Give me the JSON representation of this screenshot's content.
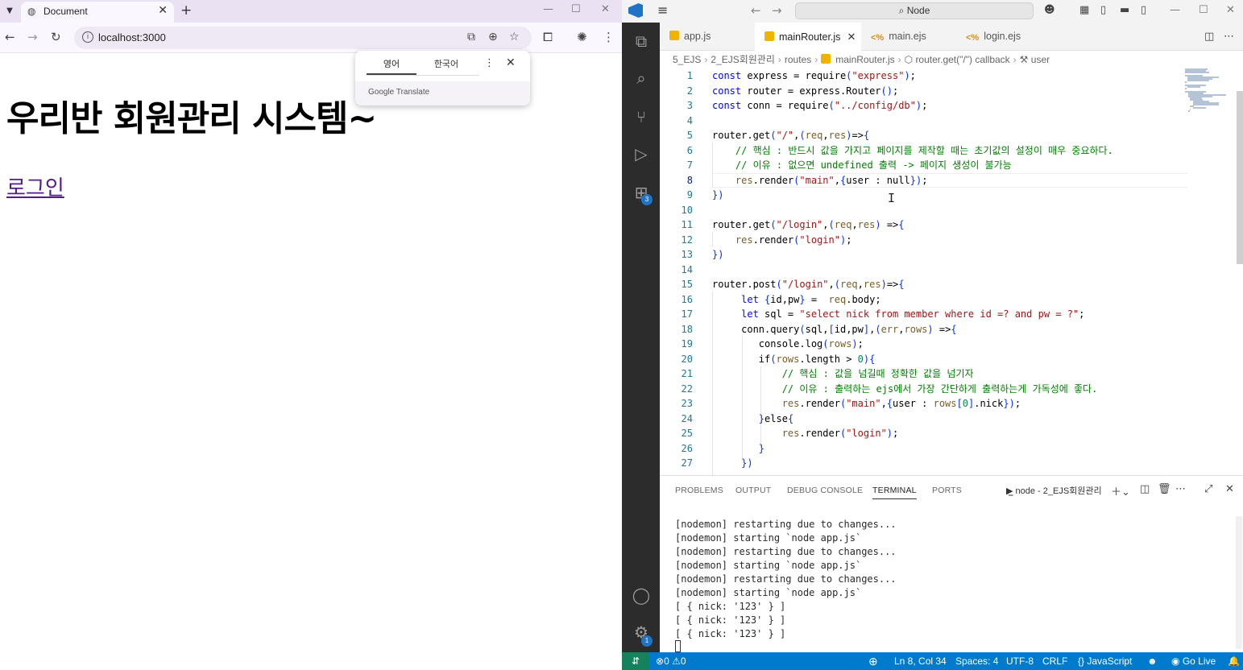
{
  "browser": {
    "tab_title": "Document",
    "new_tab": "+",
    "url": "localhost:3000",
    "translate_popup": {
      "tab_source": "영어",
      "tab_target": "한국어",
      "brand": "Google Translate"
    },
    "page": {
      "heading": "우리반 회원관리 시스템~",
      "login_link": "로그인"
    }
  },
  "vscode": {
    "search_text": "Node",
    "tabs": [
      {
        "label": "app.js",
        "icon": "js-file-icon"
      },
      {
        "label": "mainRouter.js",
        "icon": "js-file-icon",
        "active": true
      },
      {
        "label": "main.ejs",
        "icon": "ejs-file-icon"
      },
      {
        "label": "login.ejs",
        "icon": "ejs-file-icon"
      }
    ],
    "breadcrumb": [
      "5_EJS",
      "2_EJS회원관리",
      "routes",
      "mainRouter.js",
      "router.get(\"/\") callback",
      "user"
    ],
    "extensions_badge": "3",
    "settings_badge": "1",
    "code_lines": [
      "const express = require(\"express\");",
      "const router = express.Router();",
      "const conn = require(\"../config/db\");",
      "",
      "router.get(\"/\",(req,res)=>{",
      "    // 핵심 : 반드시 값을 가지고 페이지를 제작할 때는 초기값의 설정이 매우 중요하다.",
      "    // 이유 : 없으면 undefined 출력 -> 페이지 생성이 불가능",
      "    res.render(\"main\",{user : null});",
      "})",
      "",
      "router.get(\"/login\",(req,res) =>{",
      "    res.render(\"login\");",
      "})",
      "",
      "router.post(\"/login\",(req,res)=>{",
      "     let {id,pw} =  req.body;",
      "     let sql = \"select nick from member where id =? and pw = ?\";",
      "     conn.query(sql,[id,pw],(err,rows) =>{",
      "        console.log(rows);",
      "        if(rows.length > 0){",
      "            // 핵심 : 값을 넘길때 정확한 값을 넘기자",
      "            // 이유 : 출력하는 ejs에서 가장 간단하게 출력하는게 가독성에 좋다.",
      "            res.render(\"main\",{user : rows[0].nick});",
      "        }else{",
      "            res.render(\"login\");",
      "        }",
      "     })"
    ],
    "panel": {
      "tabs": [
        "PROBLEMS",
        "OUTPUT",
        "DEBUG CONSOLE",
        "TERMINAL",
        "PORTS"
      ],
      "active_tab": "TERMINAL",
      "terminal_name": "node - 2_EJS회원관리",
      "terminal_lines": [
        "[nodemon] restarting due to changes...",
        "[nodemon] starting `node app.js`",
        "[nodemon] restarting due to changes...",
        "[nodemon] starting `node app.js`",
        "[nodemon] restarting due to changes...",
        "[nodemon] starting `node app.js`",
        "[ { nick: '123' } ]",
        "[ { nick: '123' } ]",
        "[ { nick: '123' } ]"
      ]
    },
    "statusbar": {
      "errors": "0",
      "warnings": "0",
      "position": "Ln 8, Col 34",
      "spaces": "Spaces: 4",
      "encoding": "UTF-8",
      "eol": "CRLF",
      "language": "JavaScript",
      "golive": "Go Live"
    }
  },
  "colors": {
    "statusbar": "#007acc",
    "activity_bar": "#2c2c2c",
    "link_visited": "#551a8b",
    "accent": "#1f74c8"
  }
}
